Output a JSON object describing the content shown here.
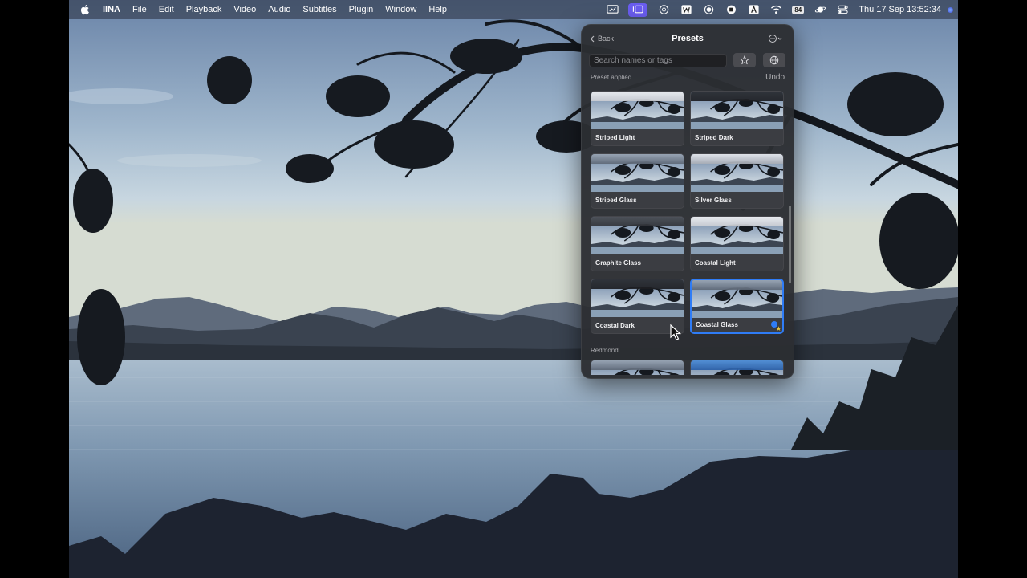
{
  "menubar": {
    "app_name": "IINA",
    "menus": [
      "File",
      "Edit",
      "Playback",
      "Video",
      "Audio",
      "Subtitles",
      "Plugin",
      "Window",
      "Help"
    ],
    "battery": "84",
    "clock": "Thu 17 Sep  13:52:34",
    "icons": [
      "screen-icon",
      "stage-manager-icon",
      "chatgpt-icon",
      "w-icon",
      "focus-icon",
      "record-icon",
      "input-source-icon",
      "wifi-icon",
      "battery-icon",
      "saturn-icon",
      "control-center-icon",
      "siri-icon"
    ]
  },
  "panel": {
    "back_label": "Back",
    "title": "Presets",
    "search_placeholder": "Search names or tags",
    "status": "Preset applied",
    "undo_label": "Undo",
    "section_title": "Redmond",
    "presets": [
      {
        "name": "Striped Light",
        "theme": "light"
      },
      {
        "name": "Striped Dark",
        "theme": "dark"
      },
      {
        "name": "Striped Glass",
        "theme": "glass"
      },
      {
        "name": "Silver Glass",
        "theme": "silver"
      },
      {
        "name": "Graphite Glass",
        "theme": "graphite"
      },
      {
        "name": "Coastal Light",
        "theme": "light"
      },
      {
        "name": "Coastal Dark",
        "theme": "dark"
      },
      {
        "name": "Coastal Glass",
        "theme": "glass",
        "selected": true,
        "favorite": true
      }
    ],
    "next_presets": [
      {
        "theme": "glass"
      },
      {
        "theme": "blue"
      }
    ]
  },
  "colors": {
    "accent": "#2f7cf6",
    "panel_bg": "#2c2e32",
    "stage_manager": "#6a5df0",
    "star": "#f2c93c"
  }
}
